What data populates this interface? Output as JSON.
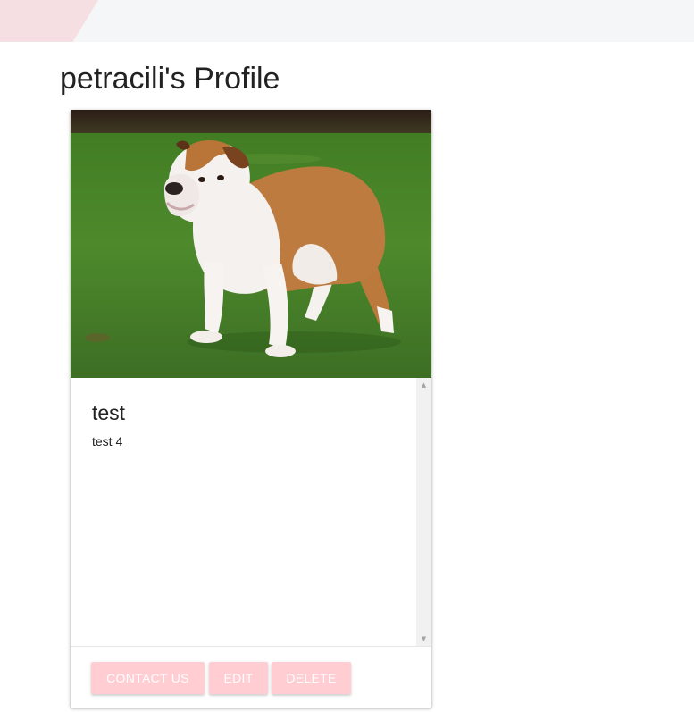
{
  "profile": {
    "title": "petracili's Profile"
  },
  "card": {
    "image_alt": "bulldog standing on grass",
    "title": "test",
    "body": "test 4",
    "actions": {
      "contact_label": "CONTACT US",
      "edit_label": "EDIT",
      "delete_label": "DELETE"
    }
  },
  "scrollbar": {
    "up_icon": "▲",
    "down_icon": "▼"
  },
  "colors": {
    "accent": "#ffcdd2",
    "header_accent": "#f6dfe2",
    "header_bg": "#f5f6f8"
  }
}
